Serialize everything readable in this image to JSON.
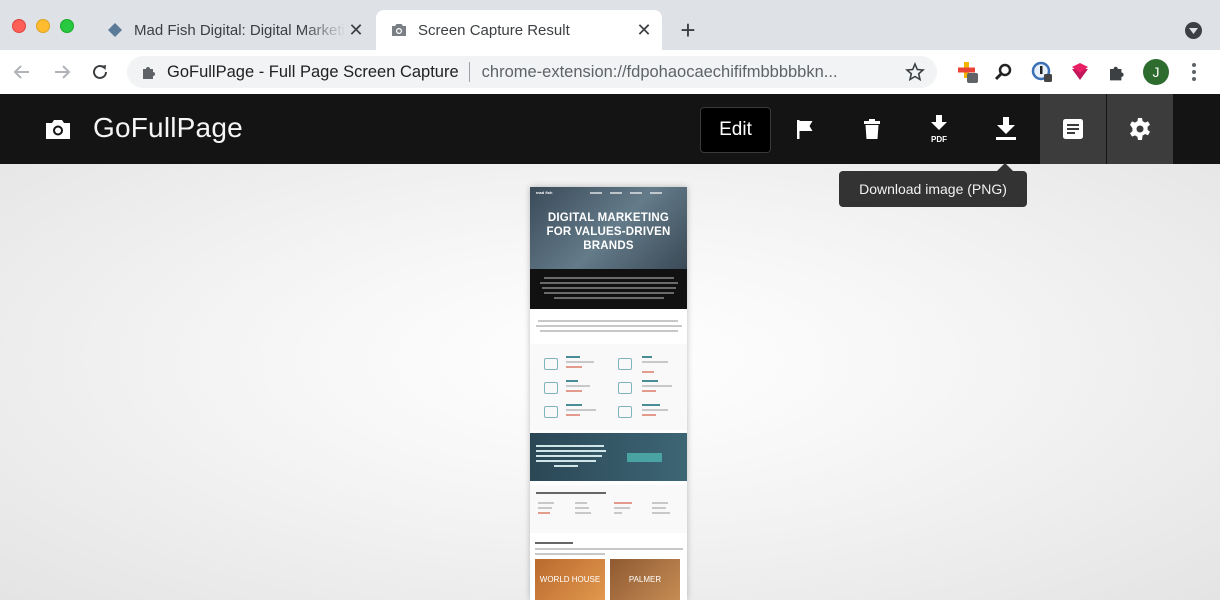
{
  "browser": {
    "tabs": [
      {
        "title": "Mad Fish Digital: Digital Marketing",
        "favicon": "diamond-favicon",
        "active": false
      },
      {
        "title": "Screen Capture Result",
        "favicon": "camera-favicon",
        "active": true
      }
    ],
    "new_tab_icon": "plus-icon",
    "close_glyph": "✕",
    "address": {
      "extension_name": "GoFullPage - Full Page Screen Capture",
      "url": "chrome-extension://fdpohaocaechififmbbbbbkn..."
    },
    "profile_initial": "J",
    "extensions": [
      "colorful-plus-icon",
      "magnifier-icon",
      "password-icon",
      "download-arrow-icon",
      "puzzle-icon"
    ]
  },
  "app": {
    "name": "GoFullPage",
    "edit_label": "Edit",
    "tools": [
      "flag-icon",
      "trash-icon",
      "download-pdf-icon",
      "download-png-icon",
      "document-icon",
      "gear-icon"
    ],
    "pdf_label": "PDF",
    "tooltip": "Download image (PNG)"
  },
  "preview": {
    "hero_title": "DIGITAL MARKETING FOR VALUES-DRIVEN BRANDS",
    "logo_text": "mad fish",
    "card_1": "WORLD HOUSE",
    "card_2": "PALMER"
  },
  "colors": {
    "appbar": "#141414",
    "tab_strip": "#dee1e6",
    "accent_teal": "#49a3a2"
  }
}
